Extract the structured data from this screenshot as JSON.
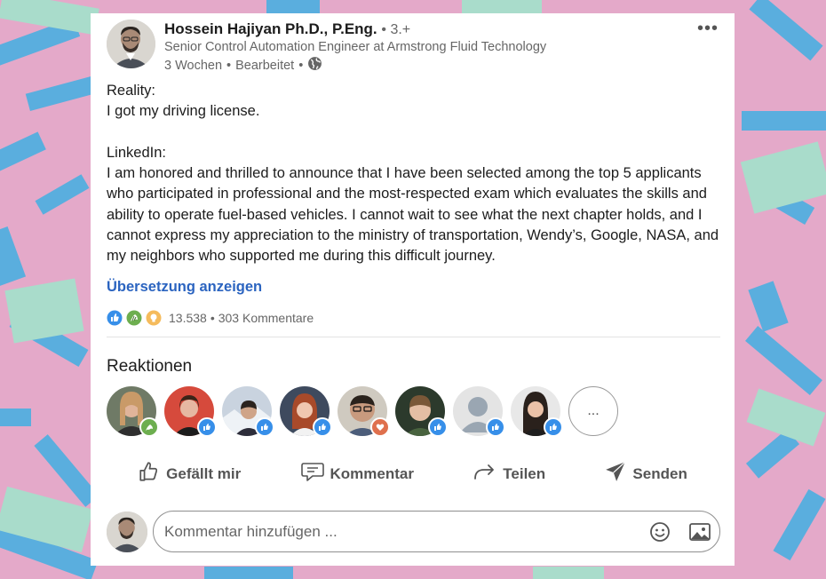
{
  "author": {
    "name": "Hossein Hajiyan Ph.D., P.Eng.",
    "degree": "• 3.+",
    "headline": "Senior Control Automation Engineer at Armstrong Fluid Technology",
    "time": "3 Wochen",
    "edited": "Bearbeitet",
    "sep": "•"
  },
  "menu": {
    "more_label": "•••"
  },
  "post": {
    "l1": "Reality:",
    "l2": "I got my driving license.",
    "l3": "LinkedIn:",
    "l4": "I am honored and thrilled to announce that I have been selected among the top 5 applicants who participated in professional and the most-respected exam which evaluates the skills and ability to operate fuel-based vehicles. I cannot wait to see what the next chapter holds, and I cannot express my appreciation to the ministry of transportation, Wendy’s, Google, NASA, and my neighbors who supported me during this difficult journey."
  },
  "translate_label": "Übersetzung anzeigen",
  "stats": {
    "reactions": "13.538",
    "sep": "•",
    "comments": "303 Kommentare"
  },
  "reactions": {
    "title": "Reaktionen",
    "more_label": "..."
  },
  "actions": {
    "like": "Gefällt mir",
    "comment": "Kommentar",
    "share": "Teilen",
    "send": "Senden"
  },
  "comment_box": {
    "placeholder": "Kommentar hinzufügen ..."
  },
  "colors": {
    "like_blue": "#378fe9",
    "link_blue": "#2b64c0",
    "celebrate_green": "#44712e",
    "love_red": "#df704d",
    "insight_yellow": "#f5bb5c",
    "bg_pink": "#e4a9c9",
    "bg_blue": "#5aaede",
    "bg_mint": "#a9dccb"
  }
}
